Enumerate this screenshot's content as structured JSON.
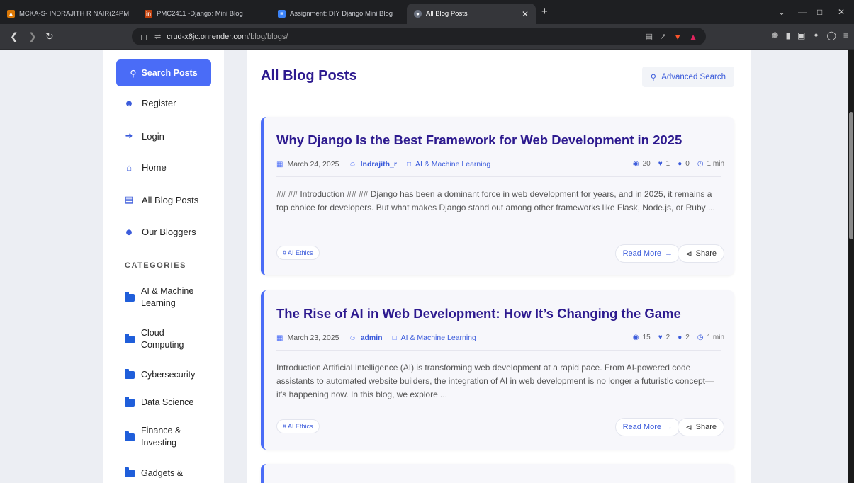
{
  "browser": {
    "tabs": [
      {
        "label": "MCKA-S- INDRAJITH R NAIR(24PM",
        "icon": "flame-icon"
      },
      {
        "label": "PMC2411 -Django: Mini Blog",
        "icon": "in-logo-icon"
      },
      {
        "label": "Assignment: DIY Django Mini Blog",
        "icon": "document-icon"
      },
      {
        "label": "All Blog Posts",
        "icon": "globe-icon"
      }
    ],
    "url_host": "crud-x6jc.onrender.com",
    "url_path": "/blog/blogs/"
  },
  "sidebar": {
    "search_label": "Search Posts",
    "nav": [
      {
        "label": "Register",
        "icon": "user-plus-icon"
      },
      {
        "label": "Login",
        "icon": "login-icon"
      },
      {
        "label": "Home",
        "icon": "home-icon"
      },
      {
        "label": "All Blog Posts",
        "icon": "blog-icon"
      },
      {
        "label": "Our Bloggers",
        "icon": "users-icon"
      }
    ],
    "categories_heading": "CATEGORIES",
    "categories": [
      {
        "line1": "AI & Machine",
        "line2": "Learning"
      },
      {
        "line1": "Cloud",
        "line2": "Computing"
      },
      {
        "line1": "Cybersecurity",
        "line2": ""
      },
      {
        "line1": "Data Science",
        "line2": ""
      },
      {
        "line1": "Finance &",
        "line2": "Investing"
      },
      {
        "line1": "Gadgets &",
        "line2": ""
      }
    ]
  },
  "main": {
    "title": "All Blog Posts",
    "advanced_search": "Advanced Search",
    "posts": [
      {
        "title": "Why Django Is the Best Framework for Web Development in 2025",
        "date": "March 24, 2025",
        "author": "Indrajith_r",
        "category": "AI & Machine Learning",
        "views": "20",
        "likes": "1",
        "comments": "0",
        "read_time": "1 min",
        "excerpt": "## ## Introduction ## ## Django has been a dominant force in web development for years, and in 2025, it remains a top choice for developers. But what makes Django stand out among other frameworks like Flask, Node.js, or Ruby ...",
        "tag": "# AI Ethics",
        "read_more": "Read More",
        "share": "Share"
      },
      {
        "title": "The Rise of AI in Web Development: How It’s Changing the Game",
        "date": "March 23, 2025",
        "author": "admin",
        "category": "AI & Machine Learning",
        "views": "15",
        "likes": "2",
        "comments": "2",
        "read_time": "1 min",
        "excerpt": "Introduction Artificial Intelligence (AI) is transforming web development at a rapid pace. From AI-powered code assistants to automated website builders, the integration of AI in web development is no longer a futuristic concept—it's happening now. In this blog, we explore ...",
        "tag": "# AI Ethics",
        "read_more": "Read More",
        "share": "Share"
      }
    ]
  }
}
